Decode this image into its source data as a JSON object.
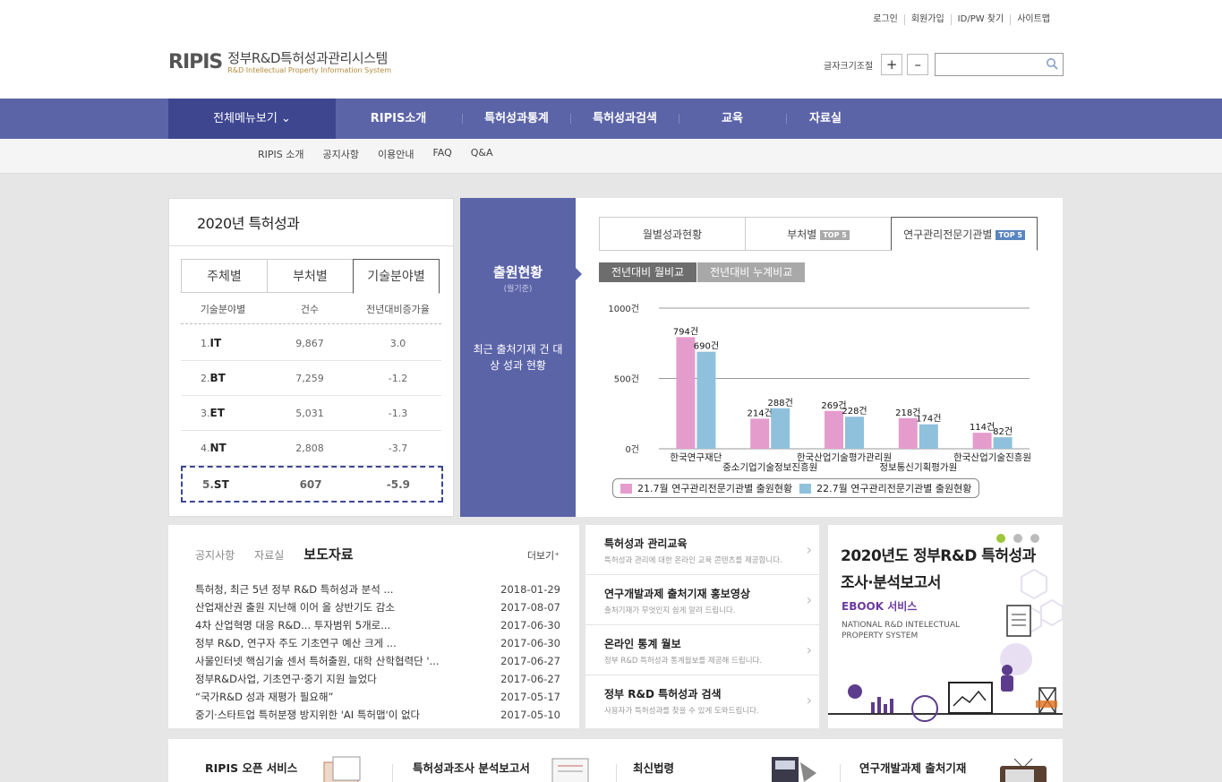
{
  "header": {
    "util_links": [
      "로그인",
      "회원가입",
      "ID/PW 찾기",
      "사이트맵"
    ],
    "logo_mark": "RIPIS",
    "logo_title": "정부R&D특허성과관리시스템",
    "logo_subtitle": "R&D Intellectual Property Information System",
    "fontsize_label": "글자크기조절",
    "fontsize_plus": "+",
    "fontsize_minus": "–",
    "search_placeholder": ""
  },
  "gnb": {
    "allmenu": "전체메뉴보기 ⌄",
    "items": [
      "RIPIS소개",
      "특허성과통계",
      "특허성과검색",
      "교육",
      "자료실"
    ]
  },
  "lnb": [
    "RIPIS 소개",
    "공지사항",
    "이용안내",
    "FAQ",
    "Q&A"
  ],
  "year_panel": {
    "title": "2020년 특허성과",
    "tabs": [
      "주체별",
      "부처별",
      "기술분야별"
    ],
    "active_tab": 2,
    "columns": [
      "기술분야별",
      "건수",
      "전년대비증가율"
    ],
    "rows": [
      {
        "rank": "1.",
        "field": "IT",
        "count": "9,867",
        "rate": "3.0"
      },
      {
        "rank": "2.",
        "field": "BT",
        "count": "7,259",
        "rate": "-1.2"
      },
      {
        "rank": "3.",
        "field": "ET",
        "count": "5,031",
        "rate": "-1.3"
      },
      {
        "rank": "4.",
        "field": "NT",
        "count": "2,808",
        "rate": "-3.7"
      },
      {
        "rank": "5.",
        "field": "ST",
        "count": "607",
        "rate": "-5.9"
      }
    ]
  },
  "chart_panel": {
    "side_title": "출원현황",
    "side_sub": "(월기준)",
    "side_desc": "최근 출처기재 건 대상 성과 현황",
    "tabs": [
      {
        "label": "월별성과현황",
        "badge": ""
      },
      {
        "label": "부처별",
        "badge": "TOP 5"
      },
      {
        "label": "연구관리전문기관별",
        "badge": "TOP 5"
      }
    ],
    "subtabs": [
      "전년대비 월비교",
      "전년대비 누계비교"
    ],
    "colors": {
      "series1": "#e49ccd",
      "series2": "#8fc1dc",
      "tab_dark": "#6d6d6d",
      "tab_light": "#a8a8a8"
    }
  },
  "chart_data": {
    "type": "bar",
    "categories": [
      "한국연구재단",
      "중소기업기술정보진흥원",
      "한국산업기술평가관리원",
      "정보통신기획평가원",
      "한국산업기술진흥원"
    ],
    "series": [
      {
        "name": "21.7월 연구관리전문기관별 출원현황",
        "values": [
          794,
          214,
          269,
          218,
          114
        ],
        "labels": [
          "794건",
          "214건",
          "269건",
          "218건",
          "114건"
        ]
      },
      {
        "name": "22.7월 연구관리전문기관별 출원현황",
        "values": [
          690,
          288,
          228,
          174,
          82
        ],
        "labels": [
          "690건",
          "288건",
          "228건",
          "174건",
          "82건"
        ]
      }
    ],
    "y_ticks": [
      "0건",
      "500건",
      "1000건"
    ],
    "ylim": [
      0,
      1000
    ],
    "grid": true,
    "legend_position": "bottom"
  },
  "news": {
    "tabs": [
      "공지사항",
      "자료실",
      "보도자료"
    ],
    "active_tab": 2,
    "more": "더보기",
    "items": [
      {
        "title": "특허청, 최근 5년 정부 R&D 특허성과 분석 ...",
        "date": "2018-01-29"
      },
      {
        "title": "산업재산권 출원 지난해 이어 올 상반기도 감소",
        "date": "2017-08-07"
      },
      {
        "title": "4차 산업혁명 대응 R&D... 투자범위 5개로...",
        "date": "2017-06-30"
      },
      {
        "title": "정부 R&D, 연구자 주도 기초연구 예산 크게 ...",
        "date": "2017-06-30"
      },
      {
        "title": "사물인터넷 핵심기술 센서 특허출원, 대학 산학협력단 '...",
        "date": "2017-06-27"
      },
      {
        "title": "정부R&D사업, 기초연구·중기 지원 늘었다",
        "date": "2017-06-27"
      },
      {
        "title": "“국가R&D 성과 재평가 필요해”",
        "date": "2017-05-17"
      },
      {
        "title": "중기·스타트업 특허분쟁 방지위한 'AI 특허맵'이 없다",
        "date": "2017-05-10"
      }
    ]
  },
  "quick_links": [
    {
      "title": "특허성과 관리교육",
      "desc": "특허성과 관리에 대한 온라인 교육 콘텐츠를 제공합니다."
    },
    {
      "title": "연구개발과제 출처기재 홍보영상",
      "desc": "출처기재가 무엇인지 쉽게 알려 드립니다."
    },
    {
      "title": "온라인 통계 월보",
      "desc": "정부 R&D 특허성과 통계월보를 제공해 드립니다."
    },
    {
      "title": "정부 R&D 특허성과 검색",
      "desc": "사용자가 특허성과를 찾을 수 있게 도와드립니다."
    }
  ],
  "banner": {
    "title_line1": "2020년도 정부R&D 특허성과",
    "title_line2": "조사·분석보고서",
    "ebook": "EBOOK 서비스",
    "english": "NATIONAL R&D INTELECTUAL PROPERTY SYSTEM"
  },
  "bottom_links": [
    "RIPIS 오픈 서비스",
    "특허성과조사 분석보고서",
    "최신법령",
    "연구개발과제 출처기재"
  ]
}
